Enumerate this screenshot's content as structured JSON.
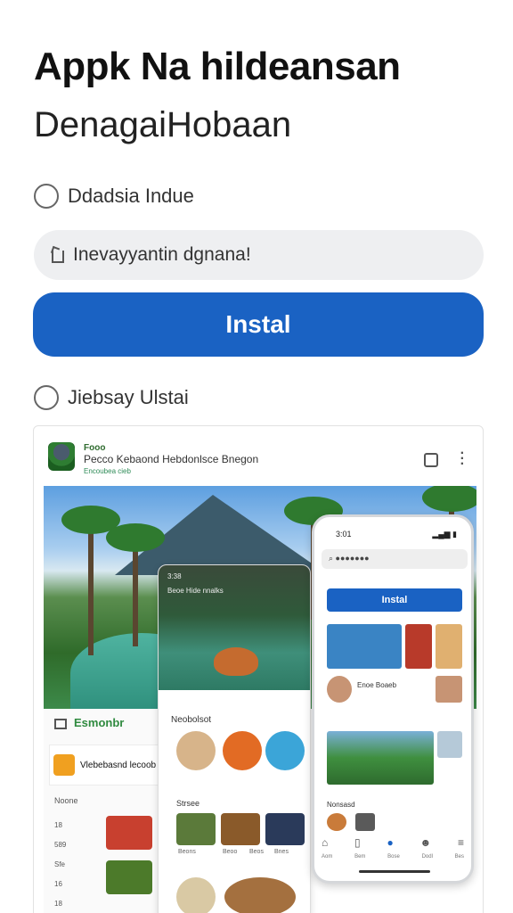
{
  "header": {
    "title": "Appk Na hildeansan",
    "subtitle": "DenagaiHobaan"
  },
  "option1": {
    "label": "Ddadsia Indue"
  },
  "search": {
    "text": "Inevayyantin dgnana!"
  },
  "install_button": {
    "label": "Instal"
  },
  "option2": {
    "label": "Jiebsay Ulstai"
  },
  "card": {
    "head_line1": "Fooo",
    "head_line2": "Pecco Kebaond Hebdonlsce Bnegon",
    "head_line3": "Encoubea cieb",
    "left_tab": "Esmonbr",
    "left_item": "Vlebebasnd lecoob",
    "left_label": "Noone",
    "left_list": [
      "18",
      "589",
      "Sfe",
      "16",
      "18"
    ],
    "mid_status": "3:38",
    "mid_header": "Beoe Hide nnalks",
    "mid_title": "Neobolsot",
    "mid_sub": "Strsee",
    "mid_captions": [
      "Beons",
      "Beoo",
      "Beos",
      "Bnes"
    ],
    "phone_time": "3:01",
    "phone_button": "Instal",
    "phone_text1": "Enoe Boaeb",
    "phone_text2": "Nonsasd",
    "phone_nav": [
      "Aom",
      "Bem",
      "Bose",
      "Dodl",
      "Bes"
    ],
    "accent": "#1a62c3"
  }
}
